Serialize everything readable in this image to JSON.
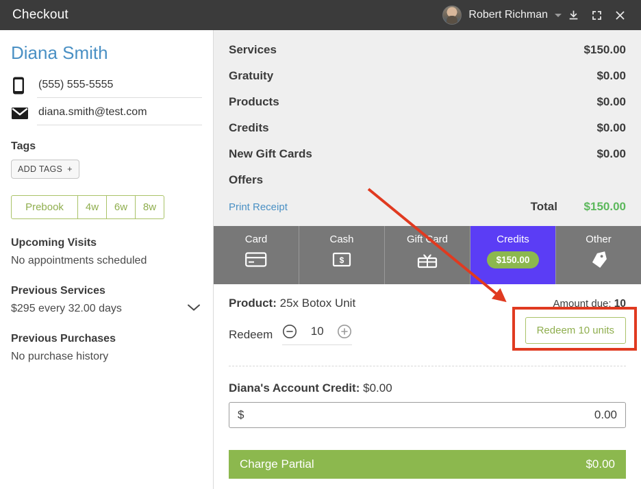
{
  "titlebar": {
    "title": "Checkout",
    "user_name": "Robert Richman",
    "avatar_name": "user-avatar",
    "minimize_label": "minimize",
    "fullscreen_label": "fullscreen",
    "close_label": "close"
  },
  "sidebar": {
    "client_name": "Diana Smith",
    "phone": "(555) 555-5555",
    "email": "diana.smith@test.com",
    "tags_label": "Tags",
    "add_tags_label": "ADD TAGS",
    "add_tags_plus": "+",
    "prebook": [
      {
        "label": "Prebook"
      },
      {
        "label": "4w"
      },
      {
        "label": "6w"
      },
      {
        "label": "8w"
      }
    ],
    "upcoming_visits_label": "Upcoming Visits",
    "upcoming_visits_value": "No appointments scheduled",
    "previous_services_label": "Previous Services",
    "previous_services_value": "$295 every 32.00 days",
    "previous_purchases_label": "Previous Purchases",
    "previous_purchases_value": "No purchase history"
  },
  "summary": {
    "rows": [
      {
        "label": "Services",
        "value": "$150.00"
      },
      {
        "label": "Gratuity",
        "value": "$0.00"
      },
      {
        "label": "Products",
        "value": "$0.00"
      },
      {
        "label": "Credits",
        "value": "$0.00"
      },
      {
        "label": "New Gift Cards",
        "value": "$0.00"
      },
      {
        "label": "Offers",
        "value": ""
      }
    ],
    "print_receipt_label": "Print Receipt",
    "total_label": "Total",
    "total_value": "$150.00"
  },
  "payment_tabs": [
    {
      "label": "Card",
      "icon": "credit-card-icon",
      "active": false,
      "badge": ""
    },
    {
      "label": "Cash",
      "icon": "cash-bill-icon",
      "active": false,
      "badge": ""
    },
    {
      "label": "Gift Card",
      "icon": "gift-card-icon",
      "active": false,
      "badge": ""
    },
    {
      "label": "Credits",
      "icon": "",
      "active": true,
      "badge": "$150.00"
    },
    {
      "label": "Other",
      "icon": "price-tag-icon",
      "active": false,
      "badge": ""
    }
  ],
  "redeem": {
    "product_label": "Product:",
    "product_value": "25x Botox Unit",
    "amount_due_label": "Amount due:",
    "amount_due_value": "10",
    "redeem_label": "Redeem",
    "quantity": "10",
    "decrement_label": "minus",
    "increment_label": "plus",
    "redeem_button_label": "Redeem 10 units"
  },
  "account_credit": {
    "title_bold": "Diana's Account Credit:",
    "title_value": "$0.00",
    "currency_symbol": "$",
    "amount_value": "0.00",
    "amount_placeholder": "0.00"
  },
  "charge": {
    "label": "Charge Partial",
    "amount": "$0.00"
  },
  "annotation": {
    "highlight_color": "#e03a20",
    "arrow_color": "#e03a20"
  },
  "colors": {
    "header_bg": "#3b3b3b",
    "accent_blue": "#4a90c4",
    "accent_green": "#8cb84e",
    "active_tab": "#5b3df5",
    "tab_bg": "#787878",
    "summary_bg": "#efefef"
  }
}
